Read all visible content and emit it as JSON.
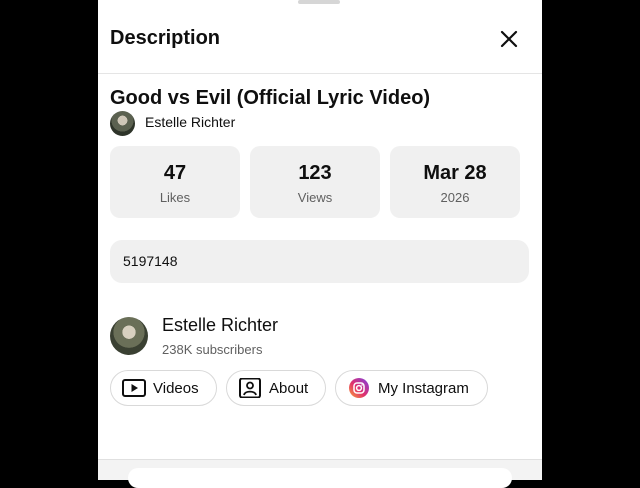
{
  "header": {
    "title": "Description"
  },
  "video": {
    "title": "Good vs Evil (Official Lyric Video)",
    "channel": "Estelle Richter"
  },
  "stats": [
    {
      "value": "47",
      "label": "Likes"
    },
    {
      "value": "123",
      "label": "Views"
    },
    {
      "value": "Mar 28",
      "label": "2026"
    }
  ],
  "description": {
    "text": "5197148"
  },
  "channel": {
    "name": "Estelle Richter",
    "subscribers": "238K subscribers"
  },
  "buttons": [
    {
      "label": "Videos",
      "icon": "play-icon"
    },
    {
      "label": "About",
      "icon": "person-icon"
    },
    {
      "label": "My Instagram",
      "icon": "instagram-icon"
    }
  ],
  "colors": {
    "background": "#000000",
    "panel": "#ffffff",
    "chip": "#f0f0f0",
    "text": "#0f0f0f",
    "muted": "#606060"
  }
}
